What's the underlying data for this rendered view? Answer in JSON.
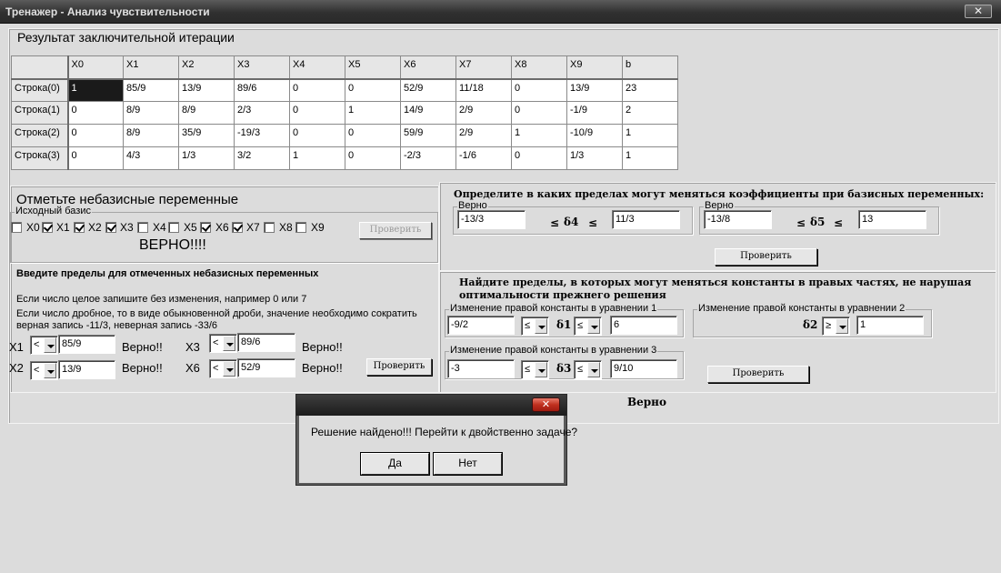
{
  "window": {
    "title": "Тренажер - Анализ чувствительности",
    "close_glyph": "✕"
  },
  "iteration": {
    "title": "Результат заключительной итерации",
    "columns": [
      "X0",
      "X1",
      "X2",
      "X3",
      "X4",
      "X5",
      "X6",
      "X7",
      "X8",
      "X9",
      "b"
    ],
    "rows": [
      {
        "label": "Строка(0)",
        "cells": [
          "1",
          "85/9",
          "13/9",
          "89/6",
          "0",
          "0",
          "52/9",
          "11/18",
          "0",
          "13/9",
          "23"
        ]
      },
      {
        "label": "Строка(1)",
        "cells": [
          "0",
          "8/9",
          "8/9",
          "2/3",
          "0",
          "1",
          "14/9",
          "2/9",
          "0",
          "-1/9",
          "2"
        ]
      },
      {
        "label": "Строка(2)",
        "cells": [
          "0",
          "8/9",
          "35/9",
          "-19/3",
          "0",
          "0",
          "59/9",
          "2/9",
          "1",
          "-10/9",
          "1"
        ]
      },
      {
        "label": "Строка(3)",
        "cells": [
          "0",
          "4/3",
          "1/3",
          "3/2",
          "1",
          "0",
          "-2/3",
          "-1/6",
          "0",
          "1/3",
          "1"
        ]
      }
    ]
  },
  "nonbasic": {
    "title": "Отметьте небазисные переменные",
    "group_label": "Исходный базис",
    "checkboxes": [
      {
        "label": "X0",
        "checked": false
      },
      {
        "label": "X1",
        "checked": true
      },
      {
        "label": "X2",
        "checked": true
      },
      {
        "label": "X3",
        "checked": true
      },
      {
        "label": "X4",
        "checked": false
      },
      {
        "label": "X5",
        "checked": false
      },
      {
        "label": "X6",
        "checked": true
      },
      {
        "label": "X7",
        "checked": true
      },
      {
        "label": "X8",
        "checked": false
      },
      {
        "label": "X9",
        "checked": false
      }
    ],
    "check_button": "Проверить",
    "result": "ВЕРНО!!!!"
  },
  "limits": {
    "title": "Введите пределы для отмеченных небазисных переменных",
    "hint1": "Если число целое запишите без изменения, например 0 или 7",
    "hint2": "Если число дробное, то в виде обыкновенной дроби, значение необходимо сократить",
    "hint3": "верная запись -11/3, неверная запись -33/6",
    "items": [
      {
        "var": "X1",
        "op": "<",
        "value": "85/9",
        "status": "Верно!!"
      },
      {
        "var": "X3",
        "op": "<",
        "value": "89/6",
        "status": "Верно!!"
      },
      {
        "var": "X2",
        "op": "<",
        "value": "13/9",
        "status": "Верно!!"
      },
      {
        "var": "X6",
        "op": "<",
        "value": "52/9",
        "status": "Верно!!"
      }
    ],
    "check_button": "Проверить"
  },
  "coef": {
    "title": "Определите в каких пределах могут меняться коэффициенты при базисных переменных:",
    "groups": [
      {
        "label": "Верно",
        "low": "-13/3",
        "le1": "≤",
        "delta": "δ4",
        "le2": "≤",
        "high": "11/3"
      },
      {
        "label": "Верно",
        "low": "-13/8",
        "le1": "≤",
        "delta": "δ5",
        "le2": "≤",
        "high": "13"
      }
    ],
    "check_button": "Проверить"
  },
  "rhs": {
    "title_line1": "Найдите пределы, в которых могут меняться константы в правых частях, не нарушая",
    "title_line2": "оптимальности прежнего решения",
    "eq1": {
      "label": "Изменение правой константы в уравнении 1",
      "low": "-9/2",
      "op1": "≤",
      "delta": "δ1",
      "op2": "≤",
      "high": "6"
    },
    "eq2": {
      "label": "Изменение правой константы в уравнении 2",
      "delta": "δ2",
      "op": "≥",
      "value": "1"
    },
    "eq3": {
      "label": "Изменение правой константы в уравнении 3",
      "low": "-3",
      "op1": "≤",
      "delta": "δ3",
      "op2": "≤",
      "high": "9/10"
    },
    "check_button": "Проверить",
    "result": "Верно"
  },
  "dialog": {
    "close_glyph": "✕",
    "message": "Решение найдено!!! Перейти к двойственно задаче?",
    "yes": "Да",
    "no": "Нет"
  }
}
